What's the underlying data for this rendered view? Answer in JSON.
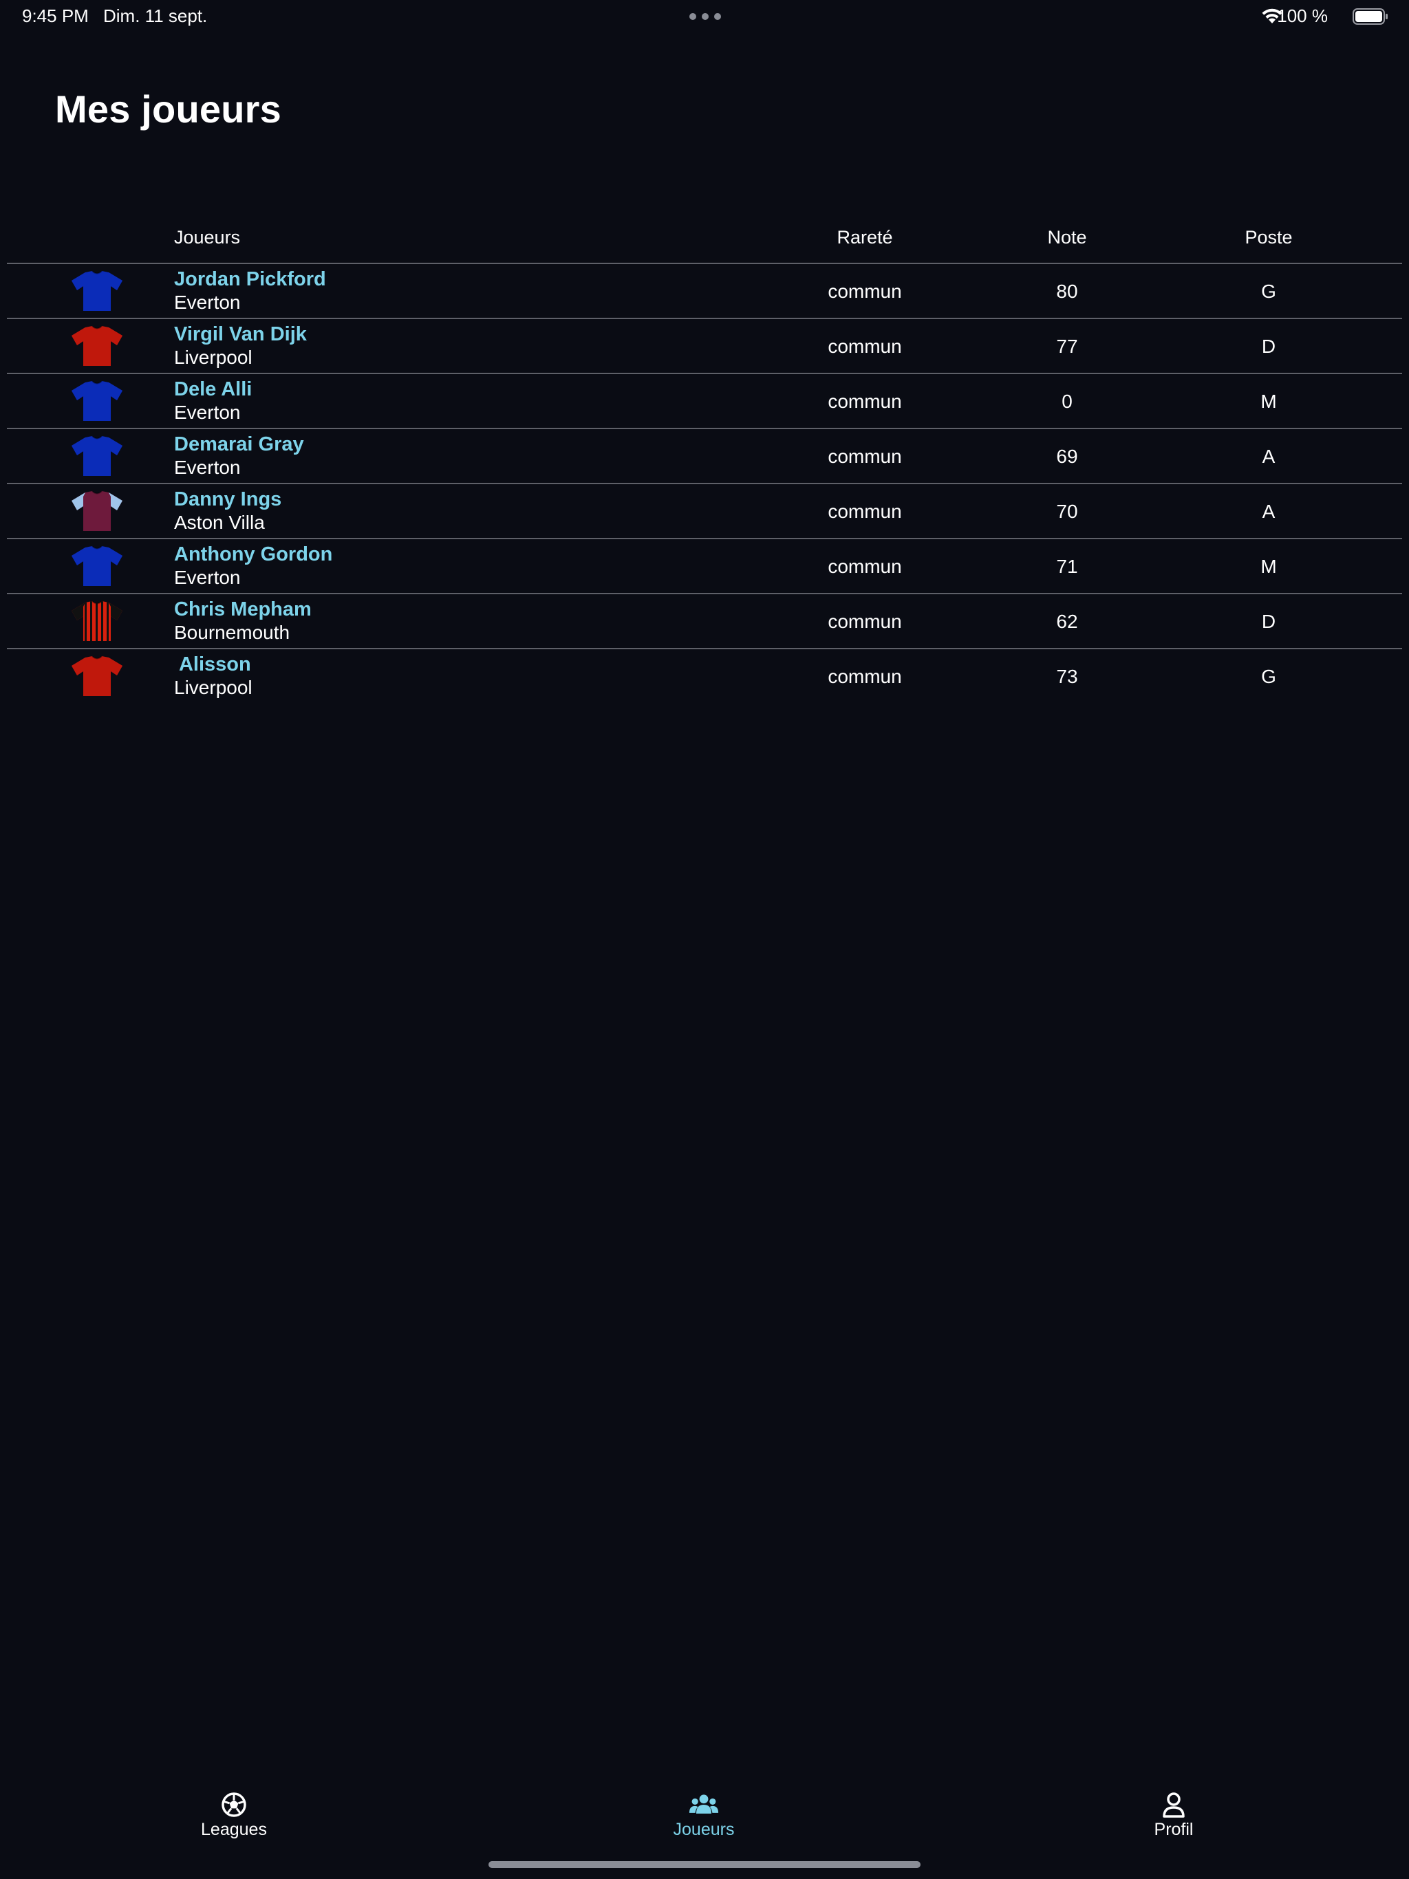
{
  "status_bar": {
    "time": "9:45 PM",
    "date": "Dim. 11 sept.",
    "battery": "100 %",
    "wifi_icon": "wifi-icon",
    "battery_icon": "battery-full-icon"
  },
  "page": {
    "title": "Mes joueurs"
  },
  "table": {
    "headers": {
      "player": "Joueurs",
      "rarity": "Rareté",
      "note": "Note",
      "position": "Poste"
    },
    "rows": [
      {
        "name": "Jordan Pickford",
        "club": "Everton",
        "rarity": "commun",
        "note": "80",
        "position": "G",
        "jersey": {
          "style": "solid",
          "body": "#0b2cb8",
          "sleeves": "#0b2cb8",
          "stripe": ""
        }
      },
      {
        "name": "Virgil Van Dijk",
        "club": "Liverpool",
        "rarity": "commun",
        "note": "77",
        "position": "D",
        "jersey": {
          "style": "solid",
          "body": "#c0180c",
          "sleeves": "#c0180c",
          "stripe": ""
        }
      },
      {
        "name": "Dele Alli",
        "club": "Everton",
        "rarity": "commun",
        "note": "0",
        "position": "M",
        "jersey": {
          "style": "solid",
          "body": "#0b2cb8",
          "sleeves": "#0b2cb8",
          "stripe": ""
        }
      },
      {
        "name": "Demarai Gray",
        "club": "Everton",
        "rarity": "commun",
        "note": "69",
        "position": "A",
        "jersey": {
          "style": "solid",
          "body": "#0b2cb8",
          "sleeves": "#0b2cb8",
          "stripe": ""
        }
      },
      {
        "name": "Danny Ings",
        "club": "Aston Villa",
        "rarity": "commun",
        "note": "70",
        "position": "A",
        "jersey": {
          "style": "solid",
          "body": "#6e1a3c",
          "sleeves": "#9fc4ea",
          "stripe": ""
        }
      },
      {
        "name": "Anthony Gordon",
        "club": "Everton",
        "rarity": "commun",
        "note": "71",
        "position": "M",
        "jersey": {
          "style": "solid",
          "body": "#0b2cb8",
          "sleeves": "#0b2cb8",
          "stripe": ""
        }
      },
      {
        "name": "Chris Mepham",
        "club": "Bournemouth",
        "rarity": "commun",
        "note": "62",
        "position": "D",
        "jersey": {
          "style": "stripes",
          "body": "#d8200e",
          "sleeves": "#111111",
          "stripe": "#111111"
        }
      },
      {
        "name": " Alisson",
        "club": "Liverpool",
        "rarity": "commun",
        "note": "73",
        "position": "G",
        "jersey": {
          "style": "solid",
          "body": "#c0180c",
          "sleeves": "#c0180c",
          "stripe": ""
        }
      }
    ]
  },
  "tab_bar": {
    "items": [
      {
        "label": "Leagues",
        "icon": "soccer-ball-icon",
        "active": false
      },
      {
        "label": "Joueurs",
        "icon": "users-icon",
        "active": true
      },
      {
        "label": "Profil",
        "icon": "person-icon",
        "active": false
      }
    ],
    "active_color": "#7dd3ea"
  }
}
